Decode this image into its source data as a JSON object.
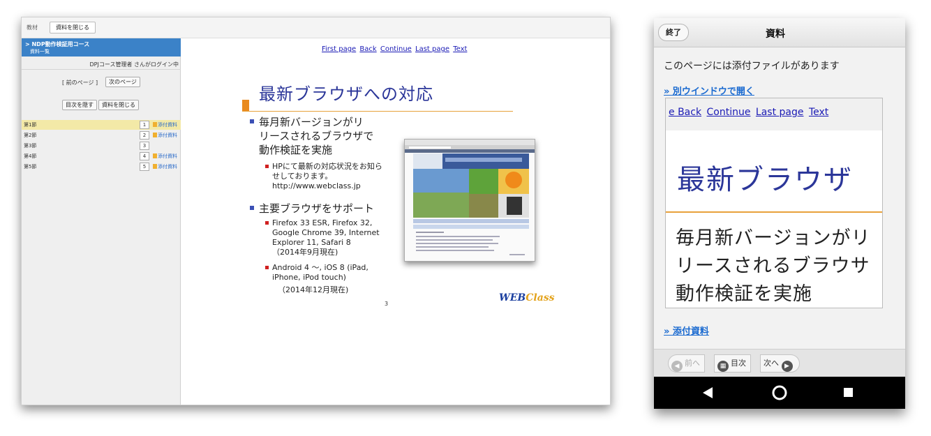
{
  "desktop": {
    "toolbar": {
      "label": "教材",
      "close_button": "資料を閉じる"
    },
    "sidebar": {
      "course_title": "> NDP動作検証用コース",
      "course_sub": "資料一覧",
      "login_line": "DPJコース管理者 さんがログイン中",
      "prev_page": "[ 前のページ ]",
      "next_page": "次のページ",
      "hide_toc": "目次を隠す",
      "close_material": "資料を閉じる",
      "sections": [
        {
          "name": "第1節",
          "num": "1",
          "attach": "添付資料"
        },
        {
          "name": "第2節",
          "num": "2",
          "attach": "添付資料"
        },
        {
          "name": "第3節",
          "num": "3",
          "attach": ""
        },
        {
          "name": "第4節",
          "num": "4",
          "attach": "添付資料"
        },
        {
          "name": "第5節",
          "num": "5",
          "attach": "添付資料"
        }
      ]
    },
    "slide": {
      "nav": [
        "First page",
        "Back",
        "Continue",
        "Last page",
        "Text"
      ],
      "title": "最新ブラウザへの対応",
      "bullet1_lines": [
        "毎月新バージョンがリ",
        "リースされるブラウザで",
        "動作検証を実施"
      ],
      "sub1_lines": [
        "HPにて最新の対応状況をお知ら",
        "せしております。",
        "http://www.webclass.jp"
      ],
      "bullet2": "主要ブラウザをサポート",
      "sub2_lines": [
        "Firefox 33 ESR, Firefox 32,",
        "Google Chrome 39, Internet",
        "Explorer 11, Safari 8",
        "（2014年9月現在)"
      ],
      "sub3_lines": [
        "Android 4 ～, iOS 8 (iPad,",
        "iPhone, iPod touch)",
        "（2014年12月現在)"
      ],
      "page_number": "3",
      "logo_main": "WEB",
      "logo_accent": "Class"
    }
  },
  "phone": {
    "end_button": "終了",
    "title": "資料",
    "notice": "このページには添付ファイルがあります",
    "open_window_link": "» 別ウインドウで開く",
    "frame_nav": [
      "e Back",
      "Continue",
      "Last page",
      "Text"
    ],
    "frame_title": "最新ブラウザ",
    "frame_lines": [
      "毎月新バージョンがリ",
      "リースされるブラウサ",
      "動作検証を実施"
    ],
    "attach_link": "» 添付資料",
    "footer": {
      "prev": "前へ",
      "toc": "目次",
      "next": "次へ"
    }
  },
  "colors": {
    "accent_blue": "#3b82c8",
    "slide_title": "#2b3699",
    "link": "#1a6ad0",
    "highlight_row": "#f3e9a7"
  }
}
